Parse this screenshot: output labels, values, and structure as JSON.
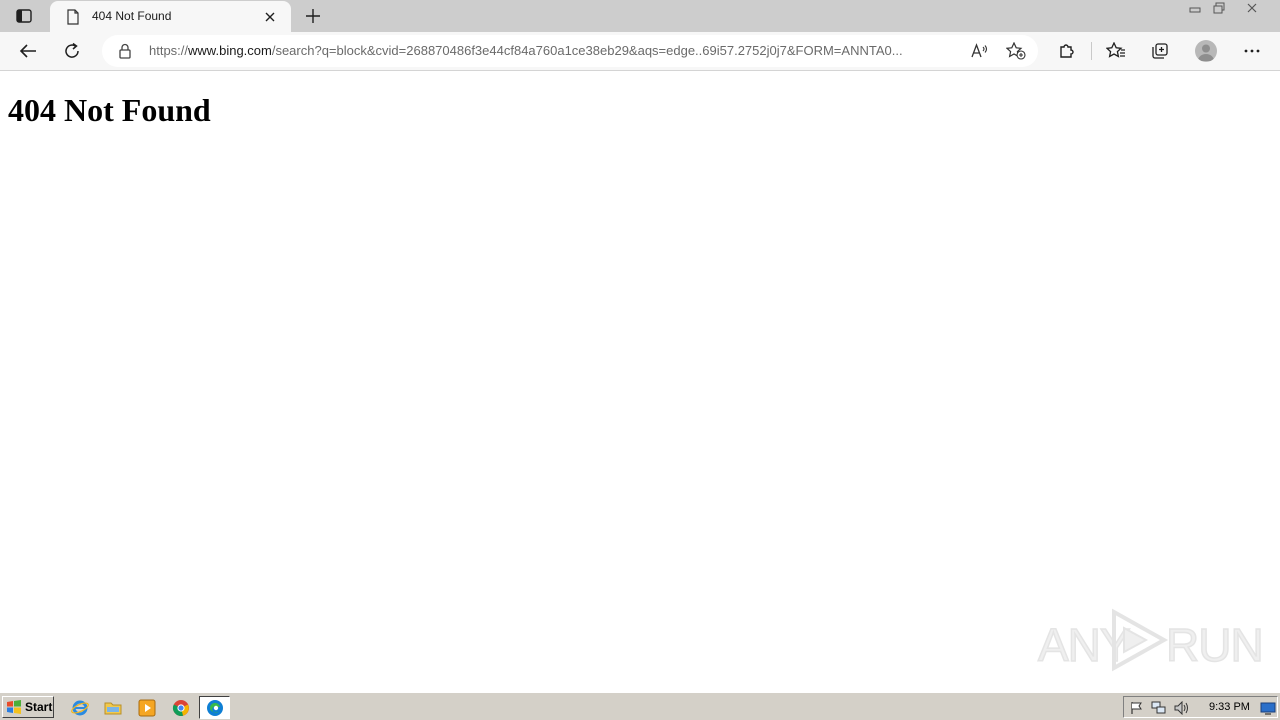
{
  "browser": {
    "tab": {
      "title": "404 Not Found"
    },
    "address": {
      "scheme": "https://",
      "host": "www.bing.com",
      "path": "/search?q=block&cvid=268870486f3e44cf84a760a1ce38eb29&aqs=edge..69i57.2752j0j7&FORM=ANNTA0..."
    },
    "icons": {
      "tab_switcher": "tab-actions-icon",
      "tab_page": "page-icon",
      "tab_close": "close-icon",
      "new_tab": "plus-icon",
      "back": "back-arrow-icon",
      "refresh": "refresh-icon",
      "lock": "lock-icon",
      "read_aloud": "read-aloud-icon",
      "add_favorite": "add-favorite-icon",
      "extensions": "puzzle-icon",
      "favorites": "favorites-star-icon",
      "collections": "collections-icon",
      "profile": "profile-avatar-icon",
      "menu": "more-dots-icon"
    }
  },
  "page": {
    "heading": "404 Not Found"
  },
  "watermark": {
    "left": "ANY",
    "right": "RUN"
  },
  "taskbar": {
    "start_label": "Start",
    "clock": "9:33 PM",
    "quick_launch": [
      "internet-explorer-icon",
      "folder-icon",
      "media-player-icon",
      "chrome-icon",
      "edge-icon"
    ],
    "tray": [
      "flag-icon",
      "network-icon",
      "volume-icon",
      "desktop-icon"
    ]
  },
  "colors": {
    "tabbar": "#cdcdcd",
    "toolbar": "#f7f7f7",
    "taskbar": "#d4d0c8",
    "edge_blue": "#0f7fd4",
    "edge_green": "#38b94a"
  }
}
